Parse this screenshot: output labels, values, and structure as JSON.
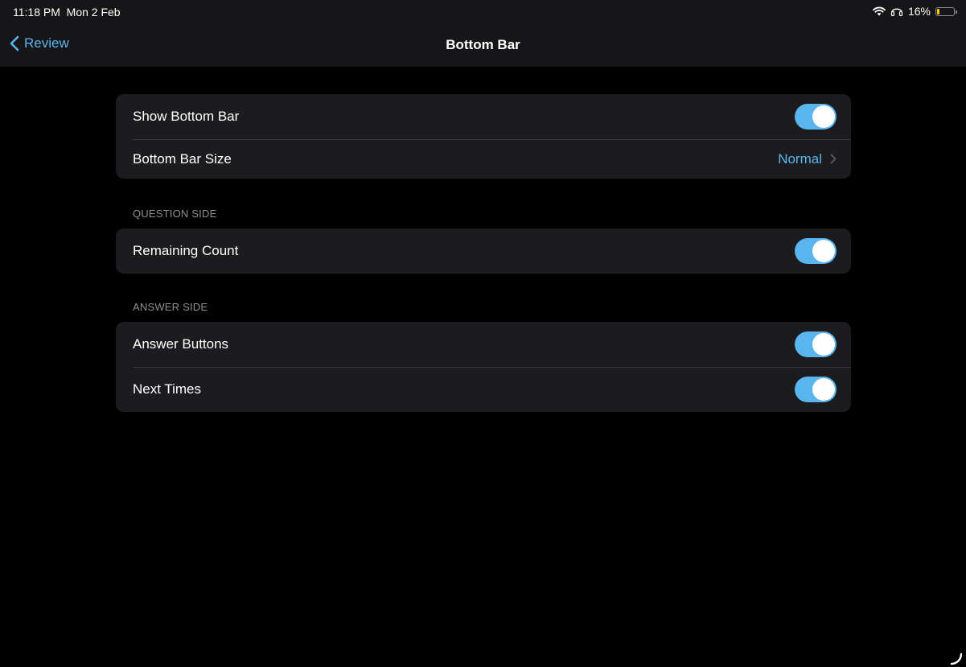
{
  "status_bar": {
    "time": "11:18 PM",
    "date": "Mon 2 Feb",
    "battery_percent": "16%",
    "battery_level": 0.16,
    "icons": [
      "wifi-icon",
      "headphones-icon",
      "battery-icon"
    ]
  },
  "nav": {
    "back_label": "Review",
    "title": "Bottom Bar"
  },
  "groups": {
    "main": {
      "show_bottom_bar": {
        "label": "Show Bottom Bar",
        "on": true
      },
      "bottom_bar_size": {
        "label": "Bottom Bar Size",
        "value": "Normal"
      }
    },
    "question_side": {
      "header": "QUESTION SIDE",
      "remaining_count": {
        "label": "Remaining Count",
        "on": true
      }
    },
    "answer_side": {
      "header": "ANSWER SIDE",
      "answer_buttons": {
        "label": "Answer Buttons",
        "on": true
      },
      "next_times": {
        "label": "Next Times",
        "on": true
      }
    }
  },
  "colors": {
    "accent": "#5ab4ee",
    "background": "#000000",
    "group_background": "#1c1c1e",
    "secondary_text": "#8e8e93",
    "battery_low": "#ffcc00"
  }
}
